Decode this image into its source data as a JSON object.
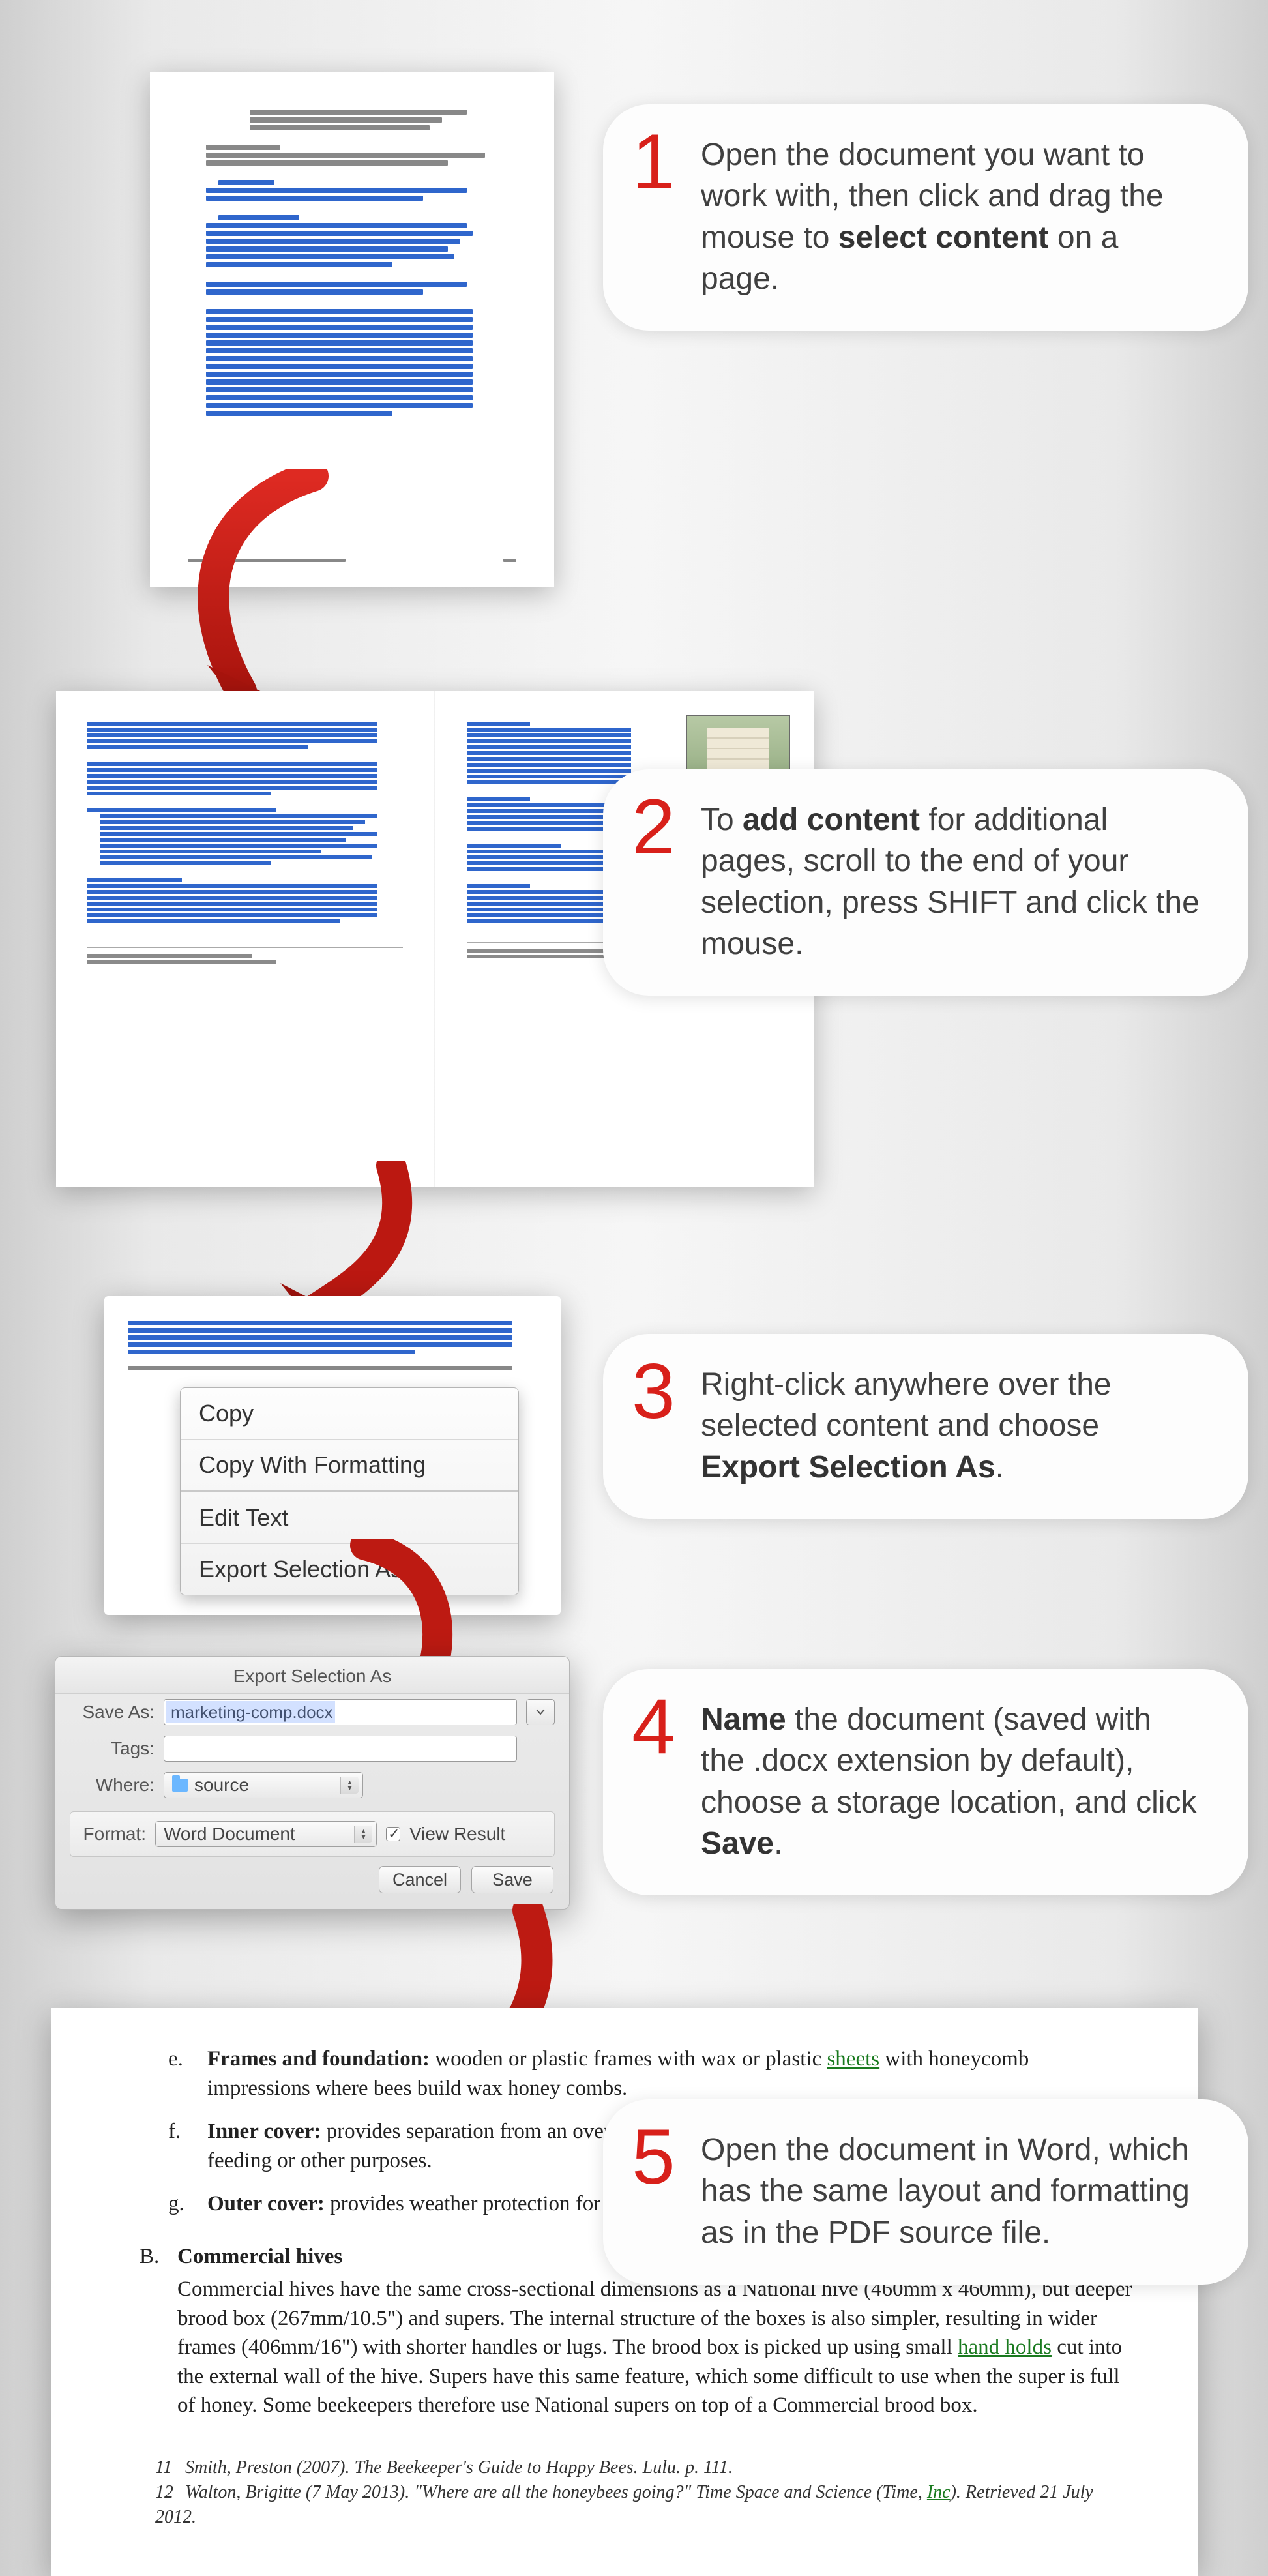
{
  "steps": {
    "s1": {
      "num": "1",
      "t1": "Open the document you want to work with, then click and drag the mouse to ",
      "b1": "select content",
      "t2": " on a page."
    },
    "s2": {
      "num": "2",
      "t1": "To ",
      "b1": "add content",
      "t2": " for additional pages, scroll to the end of your selection, press SHIFT and click the mouse."
    },
    "s3": {
      "num": "3",
      "t1": "Right-click anywhere over the selected content and choose ",
      "b1": "Export Selection As",
      "t2": "."
    },
    "s4": {
      "num": "4",
      "b0": "Name",
      "t1": " the document (saved with the .docx extension by default), choose a storage location, and click ",
      "b1": "Save",
      "t2": "."
    },
    "s5": {
      "num": "5",
      "t1": "Open the document in Word, which has the same layout and formatting as in the PDF source file."
    }
  },
  "context_menu": {
    "copy": "Copy",
    "copyfmt": "Copy With Formatting",
    "edit": "Edit Text",
    "export": "Export Selection As..."
  },
  "dialog": {
    "title": "Export Selection As",
    "save_as_label": "Save As:",
    "save_as_value": "marketing-comp.docx",
    "tags_label": "Tags:",
    "where_label": "Where:",
    "where_value": "source",
    "format_label": "Format:",
    "format_value": "Word Document",
    "view_result": "View Result",
    "cancel": "Cancel",
    "save": "Save"
  },
  "word": {
    "e_label": "e.",
    "e": "Frames and foundation:",
    "e_body_1": " wooden or plastic frames with wax or plastic ",
    "e_link": "sheets",
    "e_body_2": " with honeycomb impressions where bees build wax honey combs.",
    "f_label": "f.",
    "f": "Inner cover:",
    "f_body": " provides separation from an overly hot or cold outer cover and can be used as a shelf for feeding or other purposes.",
    "g_label": "g.",
    "g": "Outer cover:",
    "g_body": " provides weather protection for the hive.",
    "B_label": "B.",
    "B_head": "Commercial hives",
    "B_body_1": "Commercial hives have the same cross-sectional dimensions as a National hive (460mm x 460mm), but deeper brood box (267mm/10.5\") and supers. The internal structure of the boxes is also simpler, resulting in wider frames (406mm/16\") with shorter handles or lugs. The brood box is picked up using small ",
    "B_link": "hand holds",
    "B_body_2": " cut into the external wall of the hive. Supers have this same feature, which some difficult to use when the super is full of honey. Some beekeepers therefore use National supers on top of a Commercial brood box.",
    "ref11_n": "11",
    "ref11": "Smith, Preston (2007). The Beekeeper's Guide to Happy Bees. Lulu. p. 111.",
    "ref12_n": "12",
    "ref12_a": "Walton, Brigitte (7 May 2013). \"Where are all the honeybees going?\" Time Space and Science (Time, ",
    "ref12_link": "Inc",
    "ref12_b": "). Retrieved 21 July 2012."
  }
}
